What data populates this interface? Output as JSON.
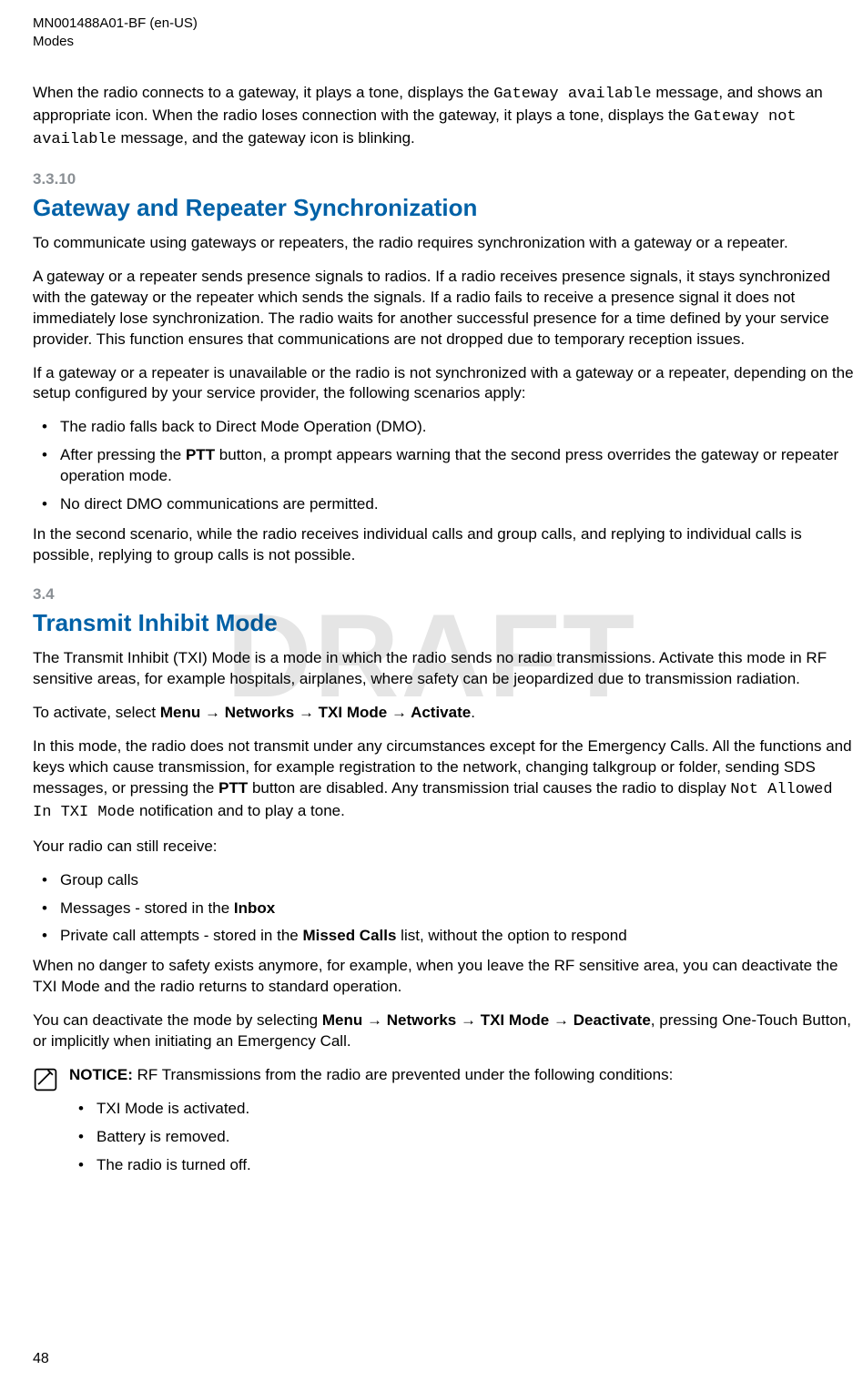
{
  "header": {
    "docnum": "MN001488A01-BF (en-US)",
    "chapter": "Modes"
  },
  "watermark": "DRAFT",
  "intro": {
    "p1a": "When the radio connects to a gateway, it plays a tone, displays the ",
    "p1code1": "Gateway available",
    "p1b": " message, and shows an appropriate icon. When the radio loses connection with the gateway, it plays a tone, displays the ",
    "p1code2": "Gateway not available",
    "p1c": " message, and the gateway icon is blinking."
  },
  "sec3310": {
    "num": "3.3.10",
    "title": "Gateway and Repeater Synchronization",
    "p1": "To communicate using gateways or repeaters, the radio requires synchronization with a gateway or a repeater.",
    "p2": "A gateway or a repeater sends presence signals to radios. If a radio receives presence signals, it stays synchronized with the gateway or the repeater which sends the signals. If a radio fails to receive a presence signal it does not immediately lose synchronization. The radio waits for another successful presence for a time defined by your service provider. This function ensures that communications are not dropped due to temporary reception issues.",
    "p3": "If a gateway or a repeater is unavailable or the radio is not synchronized with a gateway or a repeater, depending on the setup configured by your service provider, the following scenarios apply:",
    "b1": "The radio falls back to Direct Mode Operation (DMO).",
    "b2a": "After pressing the ",
    "b2ptt": "PTT",
    "b2b": " button, a prompt appears warning that the second press overrides the gateway or repeater operation mode.",
    "b3": "No direct DMO communications are permitted.",
    "p4": "In the second scenario, while the radio receives individual calls and group calls, and replying to individual calls is possible, replying to group calls is not possible."
  },
  "sec34": {
    "num": "3.4",
    "title": "Transmit Inhibit Mode",
    "p1": "The Transmit Inhibit (TXI) Mode is a mode in which the radio sends no radio transmissions. Activate this mode in RF sensitive areas, for example hospitals, airplanes, where safety can be jeopardized due to transmission radiation.",
    "activate_prefix": "To activate, select ",
    "nav_menu": "Menu",
    "arrow": " → ",
    "nav_networks": "Networks",
    "nav_txi": "TXI Mode",
    "nav_activate": "Activate",
    "nav_deactivate": "Deactivate",
    "p2a": "In this mode, the radio does not transmit under any circumstances except for the Emergency Calls. All the functions and keys which cause transmission, for example registration to the network, changing talkgroup or folder, sending SDS messages, or pressing the ",
    "p2ptt": "PTT",
    "p2b": " button are disabled. Any transmission trial causes the radio to display ",
    "p2code": "Not Allowed In TXI Mode",
    "p2c": " notification and to play a tone.",
    "p3": "Your radio can still receive:",
    "rb1": "Group calls",
    "rb2a": "Messages - stored in the ",
    "rb2bold": "Inbox",
    "rb3a": "Private call attempts - stored in the ",
    "rb3bold": "Missed Calls",
    "rb3b": " list, without the option to respond",
    "p4": "When no danger to safety exists anymore, for example, when you leave the RF sensitive area, you can deactivate the TXI Mode and the radio returns to standard operation.",
    "p5a": "You can deactivate the mode by selecting ",
    "p5b": ", pressing One-Touch Button, or implicitly when initiating an Emergency Call.",
    "notice_label": "NOTICE:",
    "notice_body": " RF Transmissions from the radio are prevented under the following conditions:",
    "nb1": "TXI Mode is activated.",
    "nb2": "Battery is removed.",
    "nb3": "The radio is turned off."
  },
  "period": ".",
  "pagenum": "48"
}
